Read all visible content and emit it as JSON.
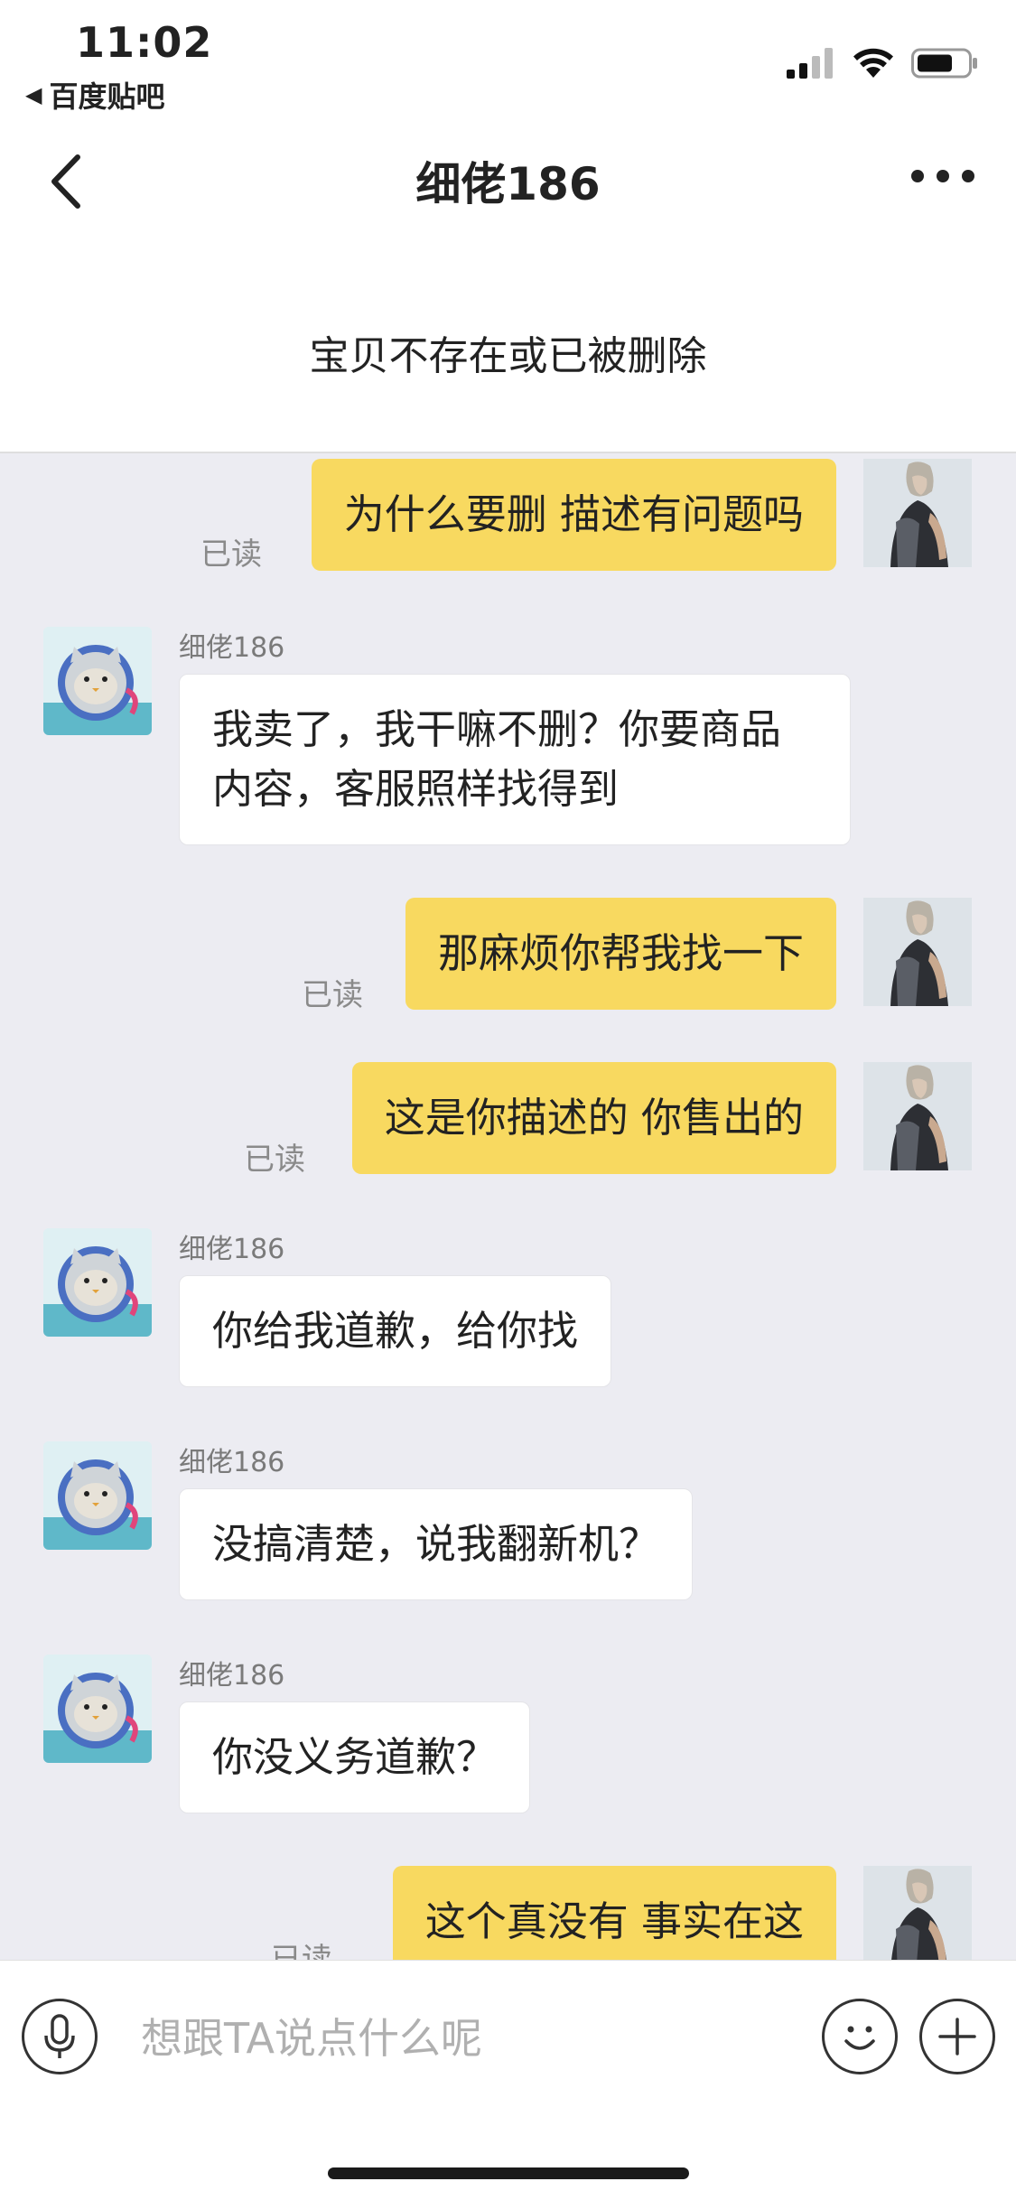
{
  "status_bar": {
    "time": "11:02",
    "back_app": "百度贴吧",
    "back_icon": "triangle-left-icon",
    "signal_icon": "cellular-signal-icon",
    "wifi_icon": "wifi-icon",
    "battery_icon": "battery-icon"
  },
  "nav": {
    "title": "细佬186",
    "back_icon": "chevron-left-icon",
    "more_icon": "more-icon"
  },
  "notice": {
    "text": "宝贝不存在或已被删除"
  },
  "messages": [
    {
      "from": "me",
      "text": "为什么要删 描述有问题吗",
      "status": "已读"
    },
    {
      "from": "other",
      "sender": "细佬186",
      "text": "我卖了，我干嘛不删？你要商品内容，客服照样找得到",
      "line1": "我卖了，我干嘛不删？你要商品",
      "line2": "内容，客服照样找得到"
    },
    {
      "from": "me",
      "text": "那麻烦你帮我找一下",
      "status": "已读"
    },
    {
      "from": "me",
      "text": "这是你描述的 你售出的",
      "status": "已读"
    },
    {
      "from": "other",
      "sender": "细佬186",
      "text": "你给我道歉，给你找"
    },
    {
      "from": "other",
      "sender": "细佬186",
      "text": "没搞清楚，说我翻新机？"
    },
    {
      "from": "other",
      "sender": "细佬186",
      "text": "你没义务道歉？"
    },
    {
      "from": "me",
      "text": "这个真没有 事实在这",
      "status": "已读"
    }
  ],
  "input": {
    "placeholder": "想跟TA说点什么呢",
    "mic_icon": "microphone-icon",
    "emoji_icon": "emoji-icon",
    "plus_icon": "plus-icon"
  }
}
